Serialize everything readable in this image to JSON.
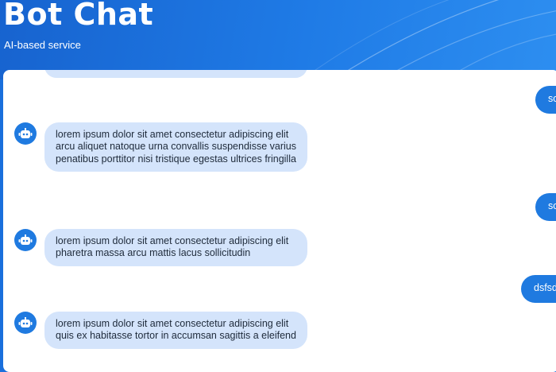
{
  "header": {
    "title": "Bot Chat",
    "subtitle": "AI-based service"
  },
  "messages": [
    {
      "sender": "user",
      "text": "sc"
    },
    {
      "sender": "bot",
      "icon": "robot-icon",
      "text": "lorem ipsum dolor sit amet consectetur adipiscing elit arcu aliquet natoque urna convallis suspendisse varius penatibus porttitor nisi tristique egestas ultrices fringilla"
    },
    {
      "sender": "user",
      "text": "sc"
    },
    {
      "sender": "bot",
      "icon": "robot-icon",
      "text": "lorem ipsum dolor sit amet consectetur adipiscing elit pharetra massa arcu mattis lacus sollicitudin"
    },
    {
      "sender": "user",
      "text": "dsfsd"
    },
    {
      "sender": "bot",
      "icon": "robot-icon",
      "text": "lorem ipsum dolor sit amet consectetur adipiscing elit quis ex habitasse tortor in accumsan sagittis a eleifend"
    }
  ],
  "colors": {
    "accent": "#1f7ae0",
    "bot_bubble": "#d4e4fb",
    "user_bubble": "#1f7ae0"
  }
}
